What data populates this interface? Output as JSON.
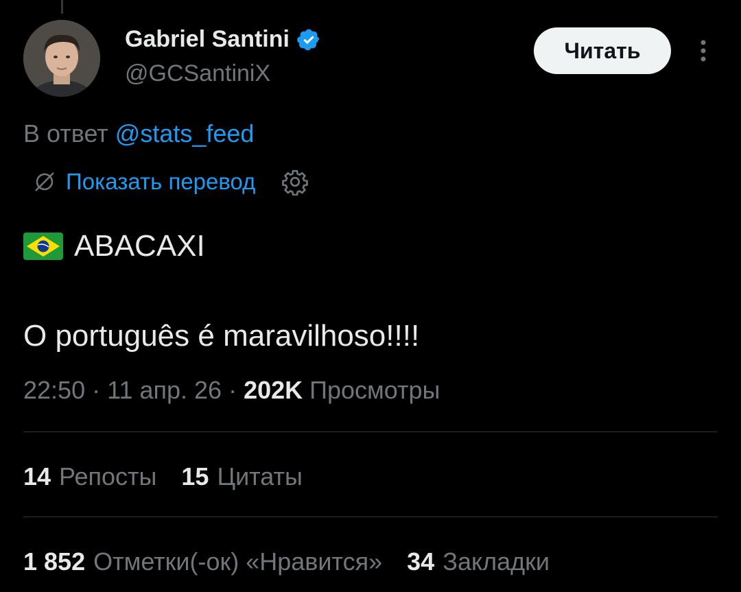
{
  "author": {
    "name": "Gabriel Santini",
    "handle": "@GCSantiniX",
    "verified": true
  },
  "follow_label": "Читать",
  "reply": {
    "prefix": "В ответ",
    "mention": "@stats_feed"
  },
  "translate_label": "Показать перевод",
  "tweet": {
    "flag_icon": "brazil-flag-icon",
    "line1": "ABACAXI",
    "line2": "O português é maravilhoso!!!!"
  },
  "meta": {
    "time": "22:50",
    "sep1": " · ",
    "date": "11 апр. 26",
    "sep2": " · ",
    "views_count": "202K",
    "views_label": "Просмотры"
  },
  "stats_row1": [
    {
      "count": "14",
      "label": "Репосты"
    },
    {
      "count": "15",
      "label": "Цитаты"
    }
  ],
  "stats_row2": [
    {
      "count": "1 852",
      "label": "Отметки(-ок) «Нравится»"
    },
    {
      "count": "34",
      "label": "Закладки"
    }
  ],
  "colors": {
    "background": "#000000",
    "accent": "#1d9bf0",
    "text_primary": "#e7e9ea",
    "text_secondary": "#71767b",
    "divider": "#2f3336"
  }
}
